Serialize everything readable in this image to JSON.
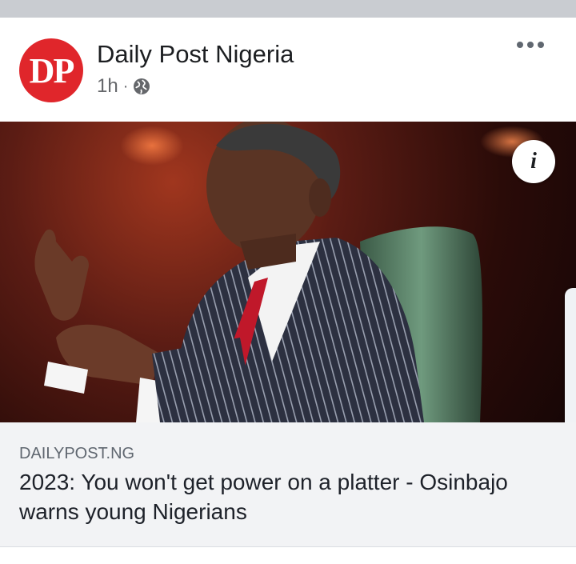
{
  "post": {
    "page_name": "Daily Post Nigeria",
    "avatar_text": "DP",
    "time": "1h",
    "separator": "·",
    "privacy_icon": "globe-icon",
    "more_icon": "more-horizontal-icon"
  },
  "image": {
    "info_icon_label": "i"
  },
  "link": {
    "domain": "DAILYPOST.NG",
    "headline": "2023: You won't get power on a platter - Osinbajo warns young Nigerians"
  },
  "colors": {
    "brand_red": "#e0262b",
    "text_primary": "#1c1e21",
    "text_secondary": "#65676b",
    "link_bg": "#f2f3f5"
  }
}
